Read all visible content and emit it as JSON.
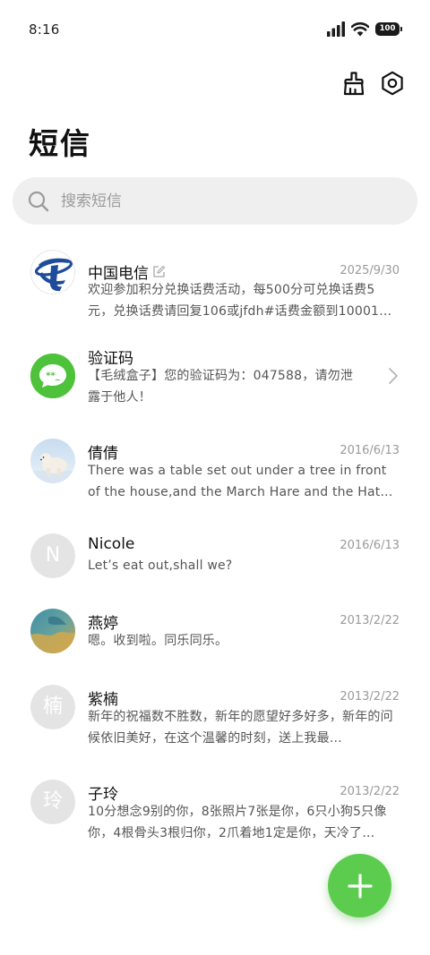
{
  "status_bar": {
    "time": "8:16",
    "battery": "100"
  },
  "header": {
    "title": "短信",
    "icons": [
      "clean-brush-icon",
      "settings-hex-icon"
    ]
  },
  "search": {
    "placeholder": "搜索短信"
  },
  "messages": [
    {
      "name": "中国电信",
      "date": "2025/9/30",
      "preview": "欢迎参加积分兑换话费活动，每500分可兑换话费5元，兑换话费请回复106或jfdh#话费金额到10001…",
      "avatar": "china-telecom-logo",
      "draft": true
    },
    {
      "name": "验证码",
      "date": "",
      "preview": "【毛绒盒子】您的验证码为：047588，请勿泄露于他人！",
      "avatar": "verification-chat-icon",
      "draft": false
    },
    {
      "name": "倩倩",
      "date": "2016/6/13",
      "preview": "There was a table set out under a tree in front of the house,and the March Hare and the Hatter we…",
      "avatar": "polar-bear-photo",
      "draft": false
    },
    {
      "name": "Nicole",
      "date": "2016/6/13",
      "preview": "Let’s eat out,shall we?",
      "avatar_letter": "N",
      "draft": false
    },
    {
      "name": "燕婷",
      "date": "2013/2/22",
      "preview": "嗯。收到啦。同乐同乐。",
      "avatar": "landscape-photo",
      "draft": false
    },
    {
      "name": "紫楠",
      "date": "2013/2/22",
      "preview": "新年的祝福数不胜数，新年的愿望好多好多，新年的问候依旧美好，在这个温馨的时刻，送上我最…",
      "avatar_letter": "楠",
      "draft": false
    },
    {
      "name": "子玲",
      "date": "2013/2/22",
      "preview": "10分想念9别的你，8张照片7张是你，6只小狗5只像你，4根骨头3根归你，2爪着地1定是你，天冷了…",
      "avatar_letter": "玲",
      "draft": false
    }
  ],
  "fab": {
    "icon": "plus-icon"
  },
  "colors": {
    "accent_green": "#5ccc4e",
    "telecom_blue": "#1e4c9a",
    "search_bg": "#efefef"
  }
}
